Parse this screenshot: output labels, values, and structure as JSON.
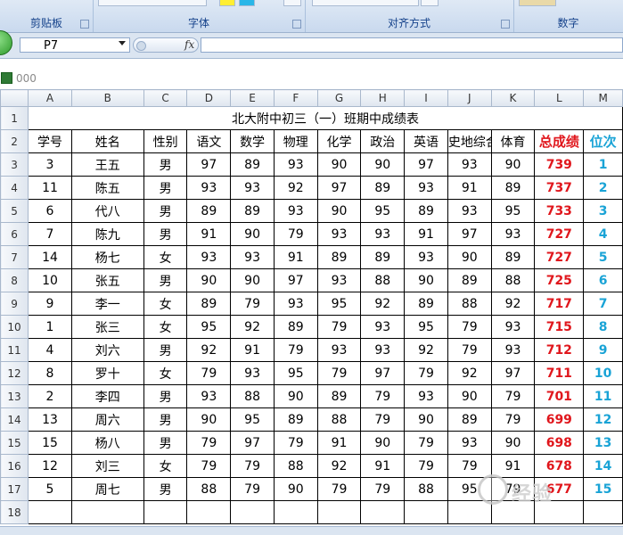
{
  "ribbon": {
    "groups": [
      {
        "label": "剪贴板"
      },
      {
        "label": "字体"
      },
      {
        "label": "对齐方式"
      },
      {
        "label": "数字"
      }
    ]
  },
  "formula_bar": {
    "name_box": "P7",
    "fx": "fx",
    "formula": ""
  },
  "workbook": {
    "title": "000"
  },
  "sheet": {
    "column_headers": [
      "A",
      "B",
      "C",
      "D",
      "E",
      "F",
      "G",
      "H",
      "I",
      "J",
      "K",
      "L",
      "M"
    ],
    "row_numbers": [
      "1",
      "2",
      "3",
      "4",
      "5",
      "6",
      "7",
      "8",
      "9",
      "10",
      "11",
      "12",
      "13",
      "14",
      "15",
      "16",
      "17",
      "18"
    ],
    "title": "北大附中初三（一）班期中成绩表",
    "headers": [
      "学号",
      "姓名",
      "性别",
      "语文",
      "数学",
      "物理",
      "化学",
      "政治",
      "英语",
      "史地综合",
      "体育",
      "总成绩",
      "位次"
    ],
    "rows": [
      [
        "3",
        "王五",
        "男",
        "97",
        "89",
        "93",
        "90",
        "90",
        "97",
        "93",
        "90",
        "739",
        "1"
      ],
      [
        "11",
        "陈五",
        "男",
        "93",
        "93",
        "92",
        "97",
        "89",
        "93",
        "91",
        "89",
        "737",
        "2"
      ],
      [
        "6",
        "代八",
        "男",
        "89",
        "89",
        "93",
        "90",
        "95",
        "89",
        "93",
        "95",
        "733",
        "3"
      ],
      [
        "7",
        "陈九",
        "男",
        "91",
        "90",
        "79",
        "93",
        "93",
        "91",
        "97",
        "93",
        "727",
        "4"
      ],
      [
        "14",
        "杨七",
        "女",
        "93",
        "93",
        "91",
        "89",
        "89",
        "93",
        "90",
        "89",
        "727",
        "5"
      ],
      [
        "10",
        "张五",
        "男",
        "90",
        "90",
        "97",
        "93",
        "88",
        "90",
        "89",
        "88",
        "725",
        "6"
      ],
      [
        "9",
        "李一",
        "女",
        "89",
        "79",
        "93",
        "95",
        "92",
        "89",
        "88",
        "92",
        "717",
        "7"
      ],
      [
        "1",
        "张三",
        "女",
        "95",
        "92",
        "89",
        "79",
        "93",
        "95",
        "79",
        "93",
        "715",
        "8"
      ],
      [
        "4",
        "刘六",
        "男",
        "92",
        "91",
        "79",
        "93",
        "93",
        "92",
        "79",
        "93",
        "712",
        "9"
      ],
      [
        "8",
        "罗十",
        "女",
        "79",
        "93",
        "95",
        "79",
        "97",
        "79",
        "92",
        "97",
        "711",
        "10"
      ],
      [
        "2",
        "李四",
        "男",
        "93",
        "88",
        "90",
        "89",
        "79",
        "93",
        "90",
        "79",
        "701",
        "11"
      ],
      [
        "13",
        "周六",
        "男",
        "90",
        "95",
        "89",
        "88",
        "79",
        "90",
        "89",
        "79",
        "699",
        "12"
      ],
      [
        "15",
        "杨八",
        "男",
        "79",
        "97",
        "79",
        "91",
        "90",
        "79",
        "93",
        "90",
        "698",
        "13"
      ],
      [
        "12",
        "刘三",
        "女",
        "79",
        "79",
        "88",
        "92",
        "91",
        "79",
        "79",
        "91",
        "678",
        "14"
      ],
      [
        "5",
        "周七",
        "男",
        "88",
        "79",
        "90",
        "79",
        "79",
        "88",
        "95",
        "79",
        "677",
        "15"
      ]
    ]
  },
  "watermark": {
    "text": "经验"
  },
  "colors": {
    "total": "#e0161c",
    "rank": "#19a3d6",
    "ribbon_text": "#15428b"
  }
}
